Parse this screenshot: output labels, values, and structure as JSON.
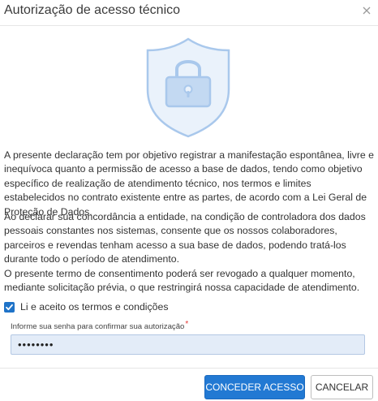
{
  "dialog": {
    "title": "Autorização de acesso técnico",
    "paragraphs": [
      "A presente declaração tem por objetivo registrar a manifestação espontânea, livre e inequívoca quanto a permissão de acesso a base de dados, tendo como objetivo específico de realização de atendimento técnico, nos termos e limites estabelecidos no contrato existente entre as partes, de acordo com a Lei Geral de Proteção de Dados.",
      "Ao declarar sua concordância a entidade, na condição de controladora dos dados pessoais constantes nos sistemas, consente que os nossos colaboradores, parceiros e revendas tenham acesso a sua base de dados, podendo tratá-los durante todo o período de atendimento.",
      "O presente termo de consentimento poderá ser revogado a qualquer momento, mediante solicitação prévia, o que restringirá nossa capacidade de atendimento."
    ],
    "consent": {
      "label": "Li e aceito os termos e condições",
      "checked": true
    },
    "password": {
      "label": "Informe sua senha para confirmar sua autorização",
      "required_mark": "*",
      "value": "••••••••"
    },
    "buttons": {
      "grant": "CONCEDER ACESSO",
      "cancel": "CANCELAR"
    },
    "icons": {
      "close": "close-icon",
      "illustration": "shield-lock-icon",
      "checkbox": "checkmark-icon"
    },
    "colors": {
      "primary": "#2279d3",
      "shield_fill": "#eaf2fb",
      "shield_stroke": "#a9c8ec",
      "lock": "#c3d9f2",
      "input_bg": "#e3ecf8",
      "required": "#e53935"
    }
  }
}
